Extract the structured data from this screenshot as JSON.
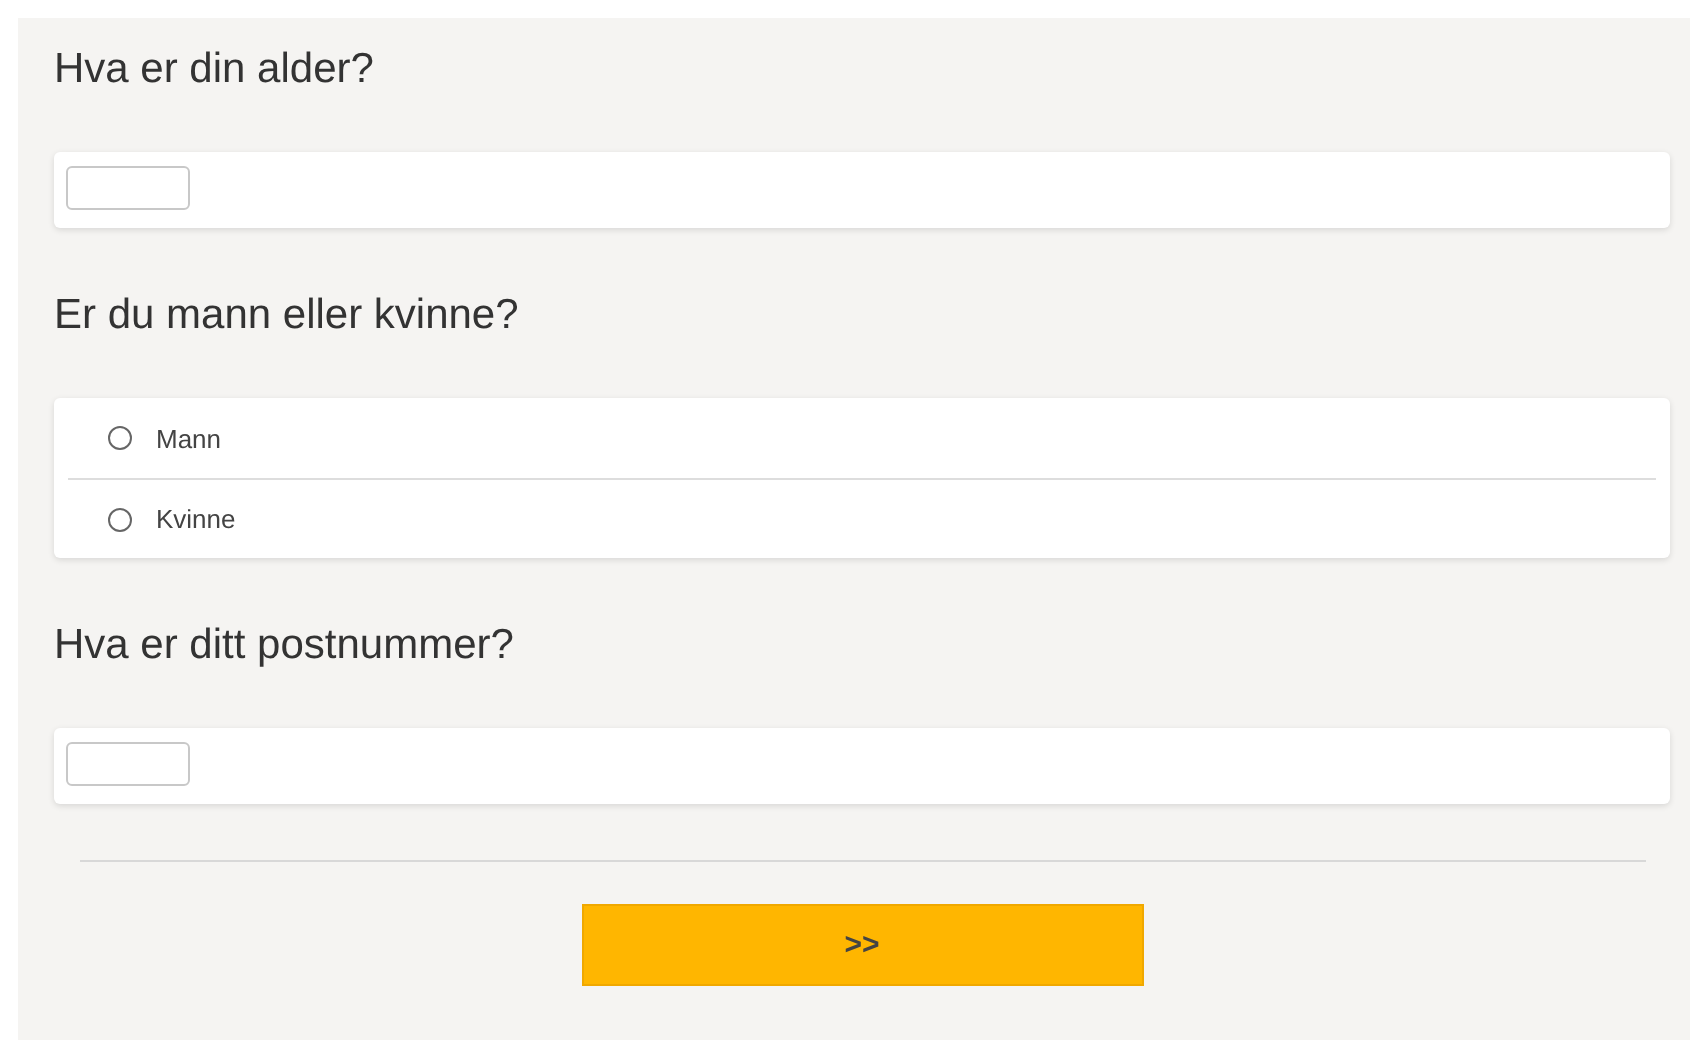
{
  "questions": [
    {
      "kind": "text",
      "title": "Hva er din alder?"
    },
    {
      "kind": "radio",
      "title": "Er du mann eller kvinne?",
      "options": [
        {
          "label": "Mann",
          "selected": false
        },
        {
          "label": "Kvinne",
          "selected": false
        }
      ]
    },
    {
      "kind": "text",
      "title": "Hva er ditt postnummer?"
    }
  ],
  "next_button": ">>"
}
